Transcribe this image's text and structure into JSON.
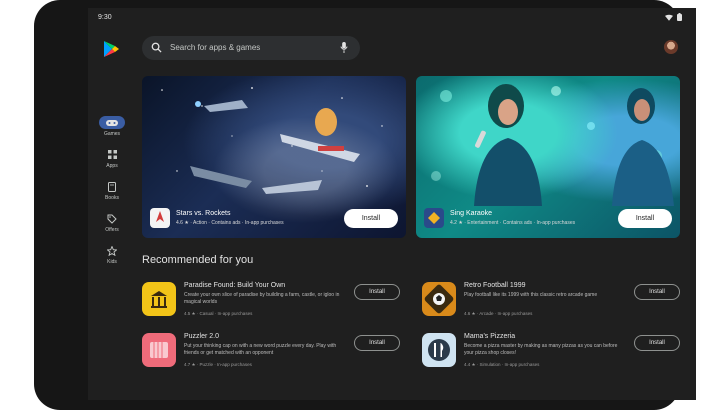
{
  "status_bar": {
    "time": "9:30",
    "icons": [
      "wifi-icon",
      "battery-icon"
    ]
  },
  "search": {
    "placeholder": "Search for apps & games"
  },
  "nav": {
    "items": [
      {
        "label": "Games",
        "icon": "gamepad-icon",
        "active": true
      },
      {
        "label": "Apps",
        "icon": "apps-grid-icon",
        "active": false
      },
      {
        "label": "Books",
        "icon": "book-icon",
        "active": false
      },
      {
        "label": "Offers",
        "icon": "tag-icon",
        "active": false
      },
      {
        "label": "Kids",
        "icon": "star-icon",
        "active": false
      }
    ]
  },
  "banners": [
    {
      "title": "Stars vs. Rockets",
      "meta": "4.6 ★ · Action · Contains ads · In-app purchases",
      "button": "Install"
    },
    {
      "title": "Sing Karaoke",
      "meta": "4.2 ★ · Entertainment · Contains ads · In-app purchases",
      "button": "Install"
    }
  ],
  "section": {
    "title": "Recommended for you"
  },
  "apps": [
    {
      "name": "Paradise Found: Build Your Own",
      "desc": "Create your own slice of paradise by building a farm, castle, or igloo in magical worlds",
      "meta": "4.5 ★ · Casual · In-app purchases",
      "button": "Install",
      "color": "#f2c418"
    },
    {
      "name": "Retro Football 1999",
      "desc": "Play football like its 1999 with this classic retro arcade game",
      "meta": "4.6 ★ · Arcade · In-app purchases",
      "button": "Install",
      "color": "#d98a1a"
    },
    {
      "name": "Puzzler 2.0",
      "desc": "Put your thinking cap on with a new word puzzle every day. Play with friends or get matched with an opponent",
      "meta": "4.7 ★ · Puzzle · In-app purchases",
      "button": "Install",
      "color": "#ef6b7a"
    },
    {
      "name": "Mama's Pizzeria",
      "desc": "Become a pizza master by making as many pizzas as you can before your pizza shop closes!",
      "meta": "4.4 ★ · Simulation · In-app purchases",
      "button": "Install",
      "color": "#cfe3f1"
    }
  ]
}
